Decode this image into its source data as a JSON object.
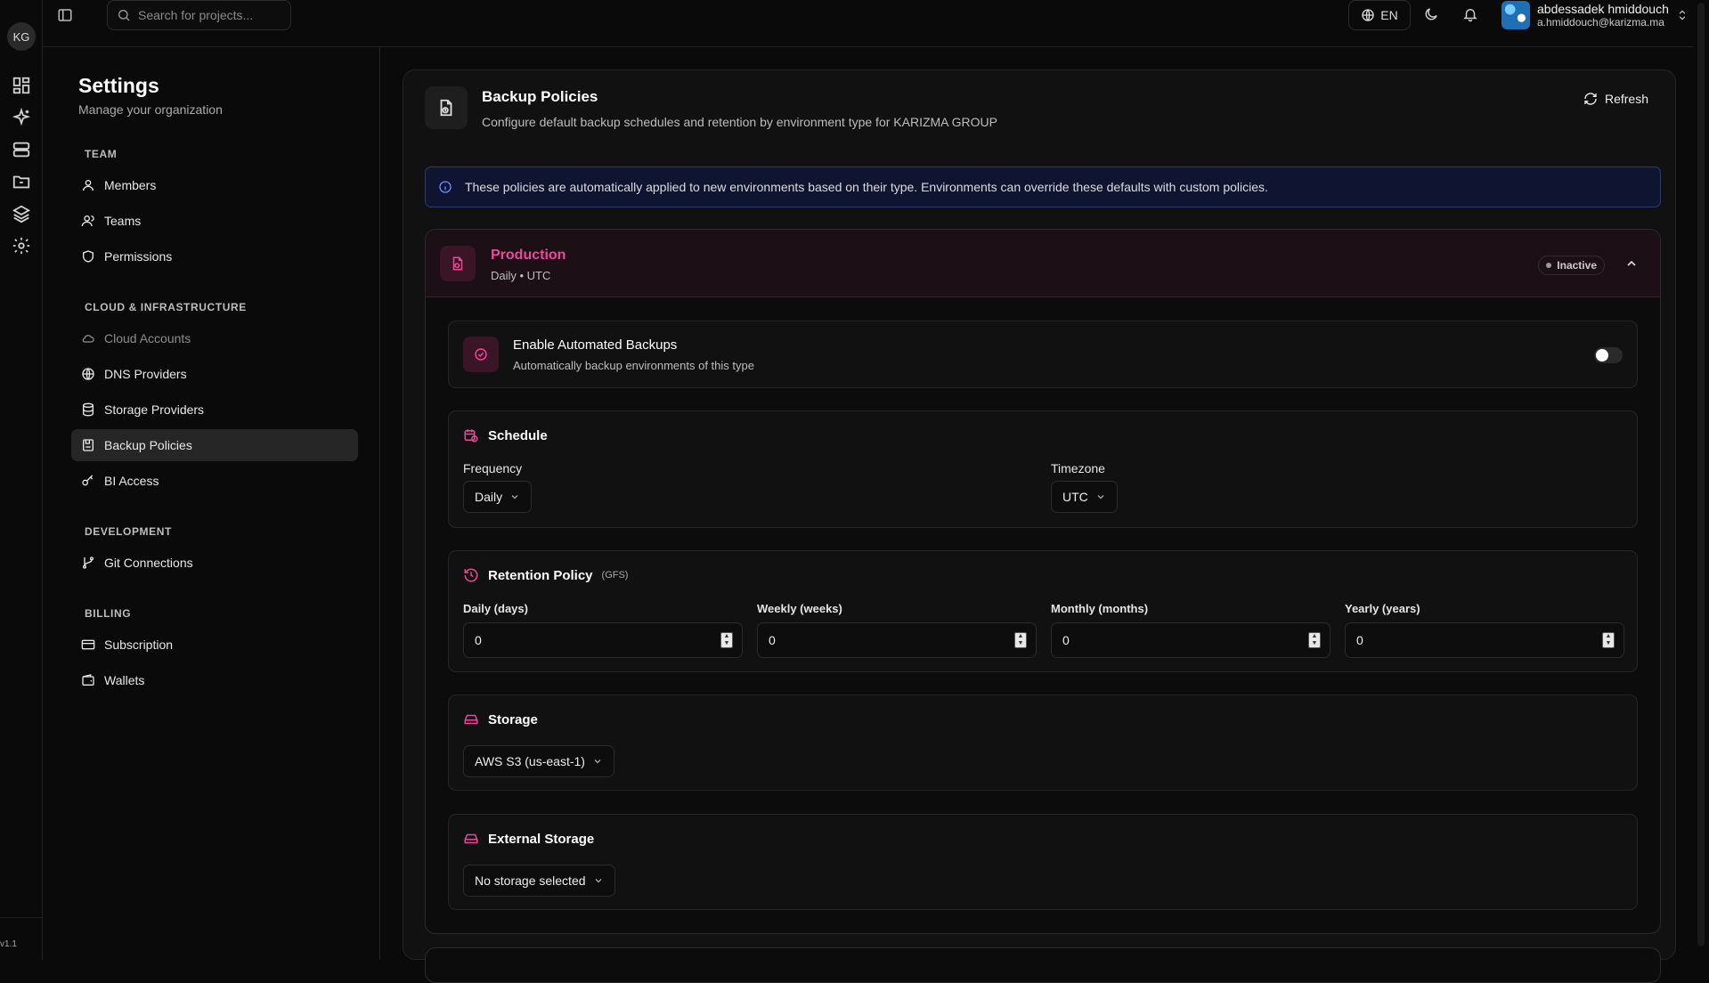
{
  "rail": {
    "org_initials": "KG",
    "version": "v1.1",
    "icons": [
      "dashboard-icon",
      "sparkles-icon",
      "server-icon",
      "folder-icon",
      "layers-icon",
      "settings-gear-icon"
    ]
  },
  "topbar": {
    "search_placeholder": "Search for projects...",
    "language": "EN",
    "user_name": "abdessadek hmiddouch",
    "user_email": "a.hmiddouch@karizma.ma"
  },
  "settings_nav": {
    "title": "Settings",
    "subtitle": "Manage your organization",
    "sections": [
      {
        "label": "TEAM",
        "items": [
          {
            "label": "Members",
            "icon": "user-icon"
          },
          {
            "label": "Teams",
            "icon": "users-icon"
          },
          {
            "label": "Permissions",
            "icon": "shield-icon"
          }
        ]
      },
      {
        "label": "CLOUD & INFRASTRUCTURE",
        "items": [
          {
            "label": "Cloud Accounts",
            "icon": "cloud-icon",
            "disabled": true
          },
          {
            "label": "DNS Providers",
            "icon": "globe-icon"
          },
          {
            "label": "Storage Providers",
            "icon": "database-icon"
          },
          {
            "label": "Backup Policies",
            "icon": "backup-icon",
            "active": true
          },
          {
            "label": "BI Access",
            "icon": "key-icon"
          }
        ]
      },
      {
        "label": "DEVELOPMENT",
        "items": [
          {
            "label": "Git Connections",
            "icon": "git-branch-icon"
          }
        ]
      },
      {
        "label": "BILLING",
        "items": [
          {
            "label": "Subscription",
            "icon": "credit-card-icon"
          },
          {
            "label": "Wallets",
            "icon": "wallet-icon"
          }
        ]
      }
    ]
  },
  "page": {
    "title": "Backup Policies",
    "description": "Configure default backup schedules and retention by environment type for KARIZMA GROUP",
    "refresh_label": "Refresh",
    "info_text": "These policies are automatically applied to new environments based on their type. Environments can override these defaults with custom policies."
  },
  "policy": {
    "name": "Production",
    "meta": "Daily • UTC",
    "status": "Inactive",
    "accent": "#ec4899",
    "automated": {
      "title": "Enable Automated Backups",
      "description": "Automatically backup environments of this type",
      "enabled": false
    },
    "schedule": {
      "title": "Schedule",
      "frequency_label": "Frequency",
      "frequency_value": "Daily",
      "timezone_label": "Timezone",
      "timezone_value": "UTC"
    },
    "retention": {
      "title": "Retention Policy",
      "tag": "(GFS)",
      "fields": [
        {
          "label": "Daily (days)",
          "value": "0"
        },
        {
          "label": "Weekly (weeks)",
          "value": "0"
        },
        {
          "label": "Monthly (months)",
          "value": "0"
        },
        {
          "label": "Yearly (years)",
          "value": "0"
        }
      ]
    },
    "storage": {
      "title": "Storage",
      "value": "AWS S3 (us-east-1)"
    },
    "external_storage": {
      "title": "External Storage",
      "value": "No storage selected"
    }
  }
}
